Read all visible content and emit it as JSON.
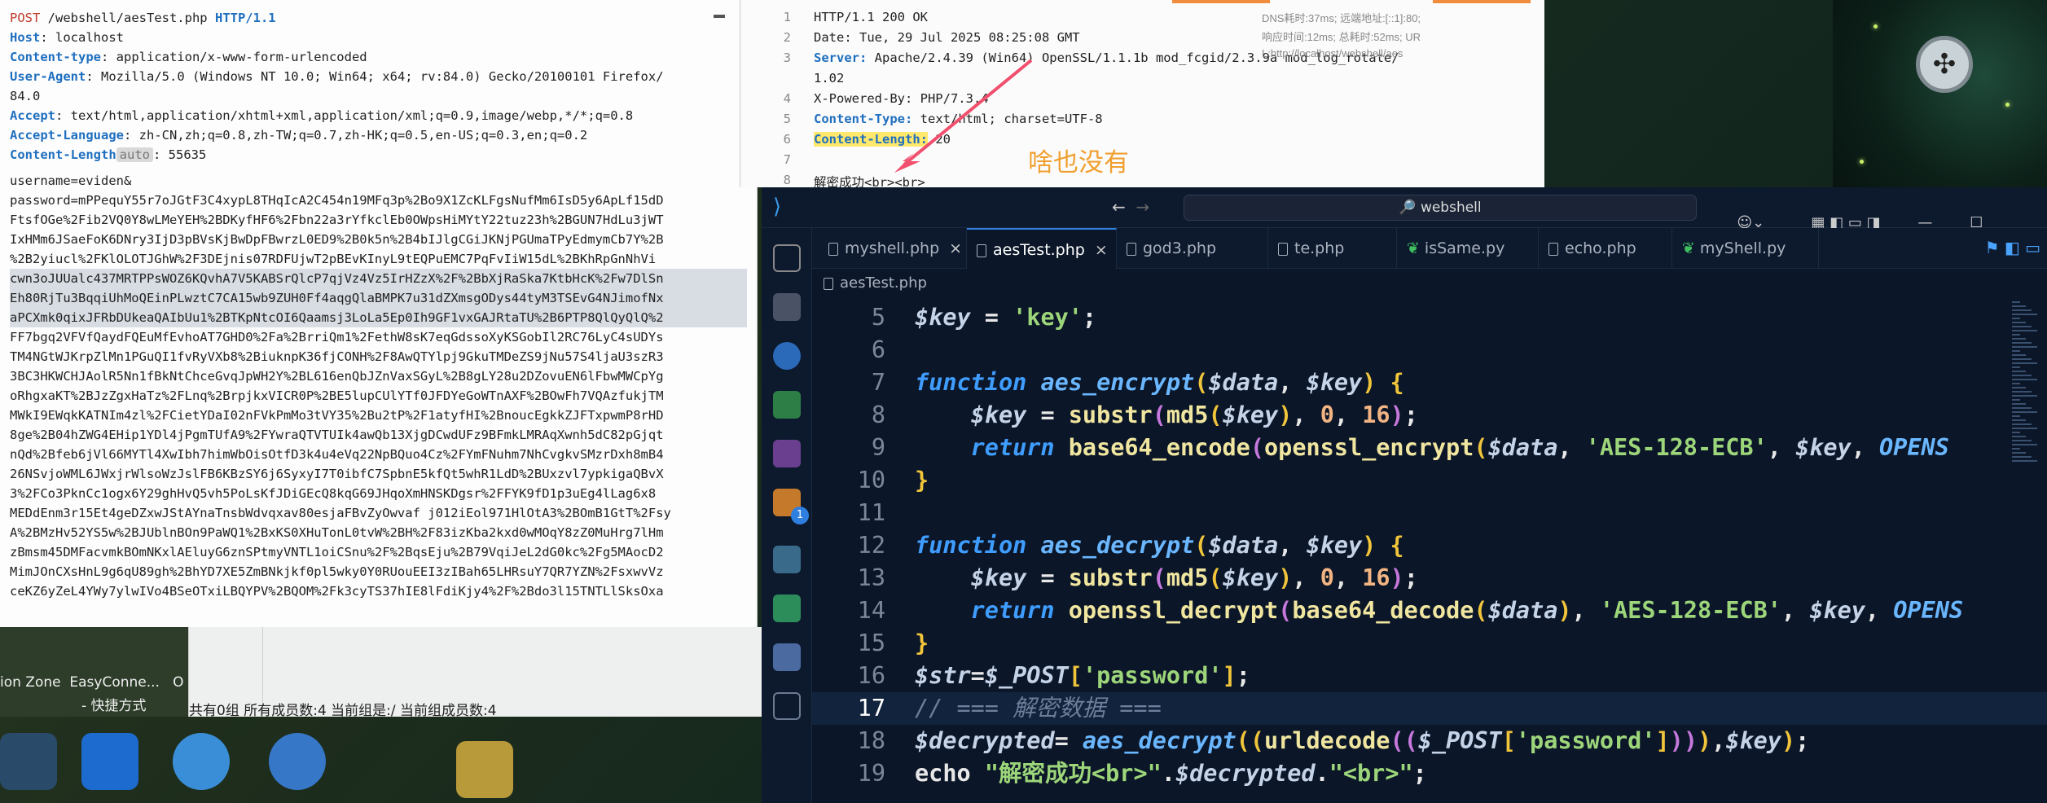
{
  "request": {
    "method": "POST",
    "path": "/webshell/aesTest.php",
    "protocol": "HTTP/1.1",
    "headers": [
      {
        "name": "Host",
        "value": "localhost"
      },
      {
        "name": "Content-type",
        "value": "application/x-www-form-urlencoded"
      },
      {
        "name": "User-Agent",
        "value": "Mozilla/5.0 (Windows NT 10.0; Win64; x64; rv:84.0) Gecko/20100101 Firefox/"
      },
      {
        "name": "",
        "value": "84.0"
      },
      {
        "name": "Accept",
        "value": "text/html,application/xhtml+xml,application/xml;q=0.9,image/webp,*/*;q=0.8"
      },
      {
        "name": "Accept-Language",
        "value": "zh-CN,zh;q=0.8,zh-TW;q=0.7,zh-HK;q=0.5,en-US;q=0.3,en;q=0.2"
      },
      {
        "name": "Content-Length",
        "badge": "auto",
        "value": "55635"
      }
    ],
    "body_lines": [
      "username=eviden&",
      "password=mPPequY55r7oJGtF3C4xypL8THqIcA2C454n19MFq3p%2Bo9X1ZcKLFgsNufMm6IsD5y6ApLf15dD",
      "FtsfOGe%2Fib2VQ0Y8wLMeYEH%2BDKyfHF6%2Fbn22a3rYfkclEb0OWpsHiMYtY22tuz23h%2BGUN7HdLu3jWT",
      "IxHMm6JSaeFoK6DNry3IjD3pBVsKjBwDpFBwrzL0ED9%2B0k5n%2B4bIJlgCGiJKNjPGUmaTPyEdmymCb7Y%2B",
      "%2B2yiucl%2FKlOLOTJGhW%2F3DEjnis07RDFUjwT2pBEvKInyL9tEQPuEMC7PqFvIiW15dL%2BKhRpGnNhVi",
      "cwn3oJUUalc437MRTPPsWOZ6KQvhA7V5KABSrQlcP7qjVz4Vz5IrHZzX%2F%2BbXjRaSka7KtbHcK%2Fw7DlSn",
      "Eh80RjTu3BqqiUhMoQEinPLwztC7CA15wb9ZUH0Ff4aqgQlaBMPK7u31dZXmsgODys44tyM3TSEvG4NJimofNx",
      "aPCXmk0qixJFRbDUkeaQAIbUu1%2BTKpNtcOI6Qaamsj3LoLa5Ep0Ih9GF1vxGAJRtaTU%2B6PTP8QlQyQlQ%2",
      "FF7bgq2VFVfQaydFQEuMfEvhoAT7GHD0%2Fa%2BrriQm1%2FethW8sK7eqGdssoXyKSGobIl2RC76LyC4sUDYs",
      "TM4NGtWJKrpZlMn1PGuQI1fvRyVXb8%2BiuknpK36fjCONH%2F8AwQTYlpj9GkuTMDeZS9jNu57S4ljaU3szR3",
      "3BC3HKWCHJAolR5Nn1fBkNtChceGvqJpWH2Y%2BL616enQbJZnVaxSGyL%2B8gLY28u2DZovuEN6lFbwMWCpYg",
      "oRhgxaKT%2BJzZgxHaTz%2FLnq%2BrpjkxVICR0P%2BE5lupCUlYTf0JFDYeGoWTnAXF%2BOwFh7VQAzfukjTM",
      "MWkI9EWqkKATNIm4zl%2FCietYDaI02nFVkPmMo3tVY35%2Bu2tP%2F1atyfHI%2BnoucEgkkZJFTxpwmP8rHD",
      "8ge%2B04hZWG4EHip1YDl4jPgmTUfA9%2FYwraQTVTUIk4awQb13XjgDCwdUFz9BFmkLMRAqXwnh5dC82pGjqt",
      "nQd%2Bfeb6jVl66MYTl4XwIbh7himWbOisOtfD3k4u4eVq22NpBQuo4Cz%2FYmFNuhm7NhCvgkvSMzrDxh8mB4",
      "26NSvjoWML6JWxjrWlsoWzJslFB6KBzSY6j6SyxyI7T0ibfC7SpbnE5kfQt5whR1LdD%2BUxzvl7ypkigaQBvX",
      "3%2FCo3PknCc1ogx6Y29ghHvQ5vh5PoLsKfJDiGEcQ8kqG69JHqoXmHNSKDgsr%2FFYK9fD1p3uEg4lLag6x8",
      "MEDdEnm3r15Et4geDZxwJStAYnaTnsbWdvqxav80esjaFBvZyOwvaf j012iEol971HlOtA3%2BOmB1GtT%2Fsy",
      "A%2BMzHv52YS5w%2BJUblnBOn9PaWQ1%2BxKS0XHuTonL0tvW%2BH%2F83izKba2kxd0wMOqY8zZ0MuHrg7lHm",
      "zBmsm45DMFacvmkBOmNKxlAEluyG6znSPtmyVNTL1oiCSnu%2F%2BqsEju%2B79VqiJeL2dG0kc%2Fg5MAocD2",
      "MimJOnCXsHnL9g6qU89gh%2BhYD7XE5ZmBNkjkf0pl5wky0Y0RUouEEI3zIBah65LHRsuY7QR7YZN%2FsxwvVz",
      "ceKZ6yZeL4YWy7ylwIVo4BSeOTxiLBQYPV%2BQOM%2Fk3cyTS37hIE8lFdiKjy4%2F%2Bdo3l15TNTLlSksOxa"
    ]
  },
  "response": {
    "lines": [
      {
        "n": "1",
        "text": "HTTP/1.1 200 OK"
      },
      {
        "n": "2",
        "text": "Date: Tue, 29 Jul 2025 08:25:08 GMT"
      },
      {
        "n": "3",
        "key": "Server:",
        "text": "Apache/2.4.39 (Win64) OpenSSL/1.1.1b mod_fcgid/2.3.9a mod_log_rotate/"
      },
      {
        "n": "",
        "text": "1.02"
      },
      {
        "n": "4",
        "text": "X-Powered-By: PHP/7.3.4"
      },
      {
        "n": "5",
        "key": "Content-Type:",
        "text": "text/html; charset=UTF-8"
      },
      {
        "n": "6",
        "key": "Content-Length:",
        "text": "20"
      },
      {
        "n": "7",
        "text": ""
      },
      {
        "n": "8",
        "text": "解密成功<br><br>"
      }
    ],
    "meta": [
      "DNS耗时:37ms; 远端地址:[::1]:80;",
      "响应时间:12ms; 总耗时:52ms; UR",
      "L:http://localhost/webshell/aes"
    ],
    "note": "啥也没有"
  },
  "desktop": {
    "group_status": "共有0组 所有成员数:4 当前组是:/ 当前组成员数:4",
    "shortcut_row": "ion Zone  EasyConne...   O",
    "shortcut_sub": "- 快捷方式"
  },
  "vscode": {
    "search": "webshell",
    "tabs": [
      {
        "label": "myshell.php",
        "kind": "php",
        "close": "×"
      },
      {
        "label": "aesTest.php",
        "kind": "php",
        "close": "×",
        "active": true
      },
      {
        "label": "god3.php",
        "kind": "php"
      },
      {
        "label": "te.php",
        "kind": "php"
      },
      {
        "label": "isSame.py",
        "kind": "py"
      },
      {
        "label": "echo.php",
        "kind": "php"
      },
      {
        "label": "myShell.py",
        "kind": "py"
      }
    ],
    "breadcrumb": "aesTest.php",
    "badge_count": "1",
    "line_numbers": [
      "5",
      "6",
      "7",
      "8",
      "9",
      "10",
      "11",
      "12",
      "13",
      "14",
      "15",
      "16",
      "17",
      "18",
      "19"
    ],
    "code": {
      "l5_key": "$key",
      "l5_val": "'key'",
      "l7_fn": "aes_encrypt",
      "l8_fn": "substr",
      "l8_md5": "md5",
      "l9_fn": "base64_encode",
      "l9_fn2": "openssl_encrypt",
      "l9_mode": "'AES-128-ECB'",
      "l9_tail": "OPENS",
      "l12_fn": "aes_decrypt",
      "l14_fn": "openssl_decrypt",
      "l14_fn2": "base64_decode",
      "l14_tail": "OPENS",
      "l16_var": "$str",
      "l16_post": "$_POST",
      "l16_key": "'password'",
      "l17_comment": "// === 解密数据 ===",
      "l18_var": "$decrypted",
      "l18_fn": "aes_decrypt",
      "l18_url": "urldecode",
      "l19_echo": "echo",
      "l19_str": "\"解密成功<br>\"",
      "l19_str2": "\"<br>\""
    }
  }
}
